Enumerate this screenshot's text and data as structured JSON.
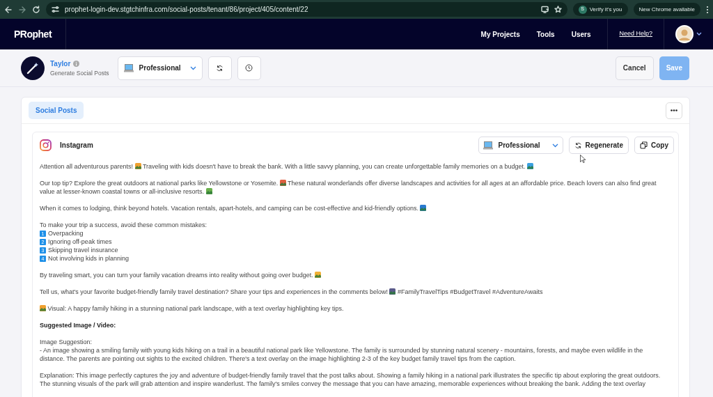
{
  "browser": {
    "url": "prophet-login-dev.stgtchinfra.com/social-posts/tenant/86/project/405/content/22",
    "profile_initial": "S",
    "profile_label": "Verify it's you",
    "update_label": "New Chrome available"
  },
  "navbar": {
    "logo": "PRophet",
    "links": [
      {
        "label": "My Projects"
      },
      {
        "label": "Tools"
      },
      {
        "label": "Users"
      }
    ],
    "help": "Need Help?"
  },
  "toolbar": {
    "assistant": "Taylor",
    "subtitle": "Generate Social Posts",
    "tone": "Professional",
    "cancel": "Cancel",
    "save": "Save",
    "save_disabled": true
  },
  "tabs": [
    {
      "label": "Social Posts",
      "selected": true
    }
  ],
  "post": {
    "platform": "Instagram",
    "tone": "Professional",
    "regenerate": "Regenerate",
    "copy": "Copy",
    "blocks": [
      {
        "kind": "para",
        "lines": [
          [
            {
              "kind": "text",
              "text": "Attention all adventurous parents! "
            },
            {
              "kind": "emoji"
            },
            {
              "kind": "text",
              "text": " Traveling with kids doesn't have to break the bank. With a little savvy planning, you can create unforgettable family memories on a budget. "
            },
            {
              "kind": "emoji"
            }
          ]
        ]
      },
      {
        "kind": "para",
        "lines": [
          [
            {
              "kind": "text",
              "text": "Our top tip? Explore the great outdoors at national parks like Yellowstone or Yosemite. "
            },
            {
              "kind": "emoji"
            },
            {
              "kind": "text",
              "text": " These natural wonderlands offer diverse landscapes and activities for all ages at an affordable price. Beach lovers can also find great"
            }
          ],
          [
            {
              "kind": "text",
              "text": "value at lesser-known coastal towns or all-inclusive resorts. "
            },
            {
              "kind": "emoji"
            }
          ]
        ]
      },
      {
        "kind": "para",
        "lines": [
          [
            {
              "kind": "text",
              "text": "When it comes to lodging, think beyond hotels. Vacation rentals, apart-hotels, and camping can be cost-effective and kid-friendly options. "
            },
            {
              "kind": "emoji"
            }
          ]
        ]
      },
      {
        "kind": "list",
        "intro": "To make your trip a success, avoid these common mistakes:",
        "items": [
          {
            "number": "1",
            "text": "Overpacking"
          },
          {
            "number": "2",
            "text": "Ignoring off-peak times"
          },
          {
            "number": "3",
            "text": "Skipping travel insurance"
          },
          {
            "number": "4",
            "text": "Not involving kids in planning"
          }
        ]
      },
      {
        "kind": "para",
        "lines": [
          [
            {
              "kind": "text",
              "text": "By traveling smart, you can turn your family vacation dreams into reality without going over budget. "
            },
            {
              "kind": "emoji"
            }
          ]
        ]
      },
      {
        "kind": "para",
        "lines": [
          [
            {
              "kind": "text",
              "text": "Tell us, what's your favorite budget-friendly family travel destination? Share your tips and experiences in the comments below! "
            },
            {
              "kind": "emoji"
            },
            {
              "kind": "text",
              "text": " #FamilyTravelTips #BudgetTravel #AdventureAwaits"
            }
          ]
        ]
      },
      {
        "kind": "para",
        "lines": [
          [
            {
              "kind": "emoji"
            },
            {
              "kind": "text",
              "text": " Visual: A happy family hiking in a stunning national park landscape, with a text overlay highlighting key tips."
            }
          ]
        ]
      },
      {
        "kind": "heading",
        "text": "Suggested Image / Video:"
      },
      {
        "kind": "para",
        "lines": [
          [
            {
              "kind": "text",
              "text": "Image Suggestion:"
            }
          ],
          [
            {
              "kind": "text",
              "text": "- An image showing a smiling family with young kids hiking on a trail in a beautiful national park like Yellowstone. The family is surrounded by stunning natural scenery - mountains, forests, and maybe even wildlife in the"
            }
          ],
          [
            {
              "kind": "text",
              "text": "distance. The parents are pointing out sights to the excited children. There's a text overlay on the image highlighting 2-3 of the key budget family travel tips from the caption."
            }
          ]
        ]
      },
      {
        "kind": "para",
        "lines": [
          [
            {
              "kind": "text",
              "text": "Explanation: This image perfectly captures the joy and adventure of budget-friendly family travel that the post talks about. Showing a family hiking in a national park illustrates the specific tip about exploring the great outdoors."
            }
          ],
          [
            {
              "kind": "text",
              "text": "The stunning visuals of the park will grab attention and inspire wanderlust. The family's smiles convey the message that you can have amazing, memorable experiences without breaking the bank. Adding the text overlay"
            }
          ]
        ]
      }
    ]
  }
}
